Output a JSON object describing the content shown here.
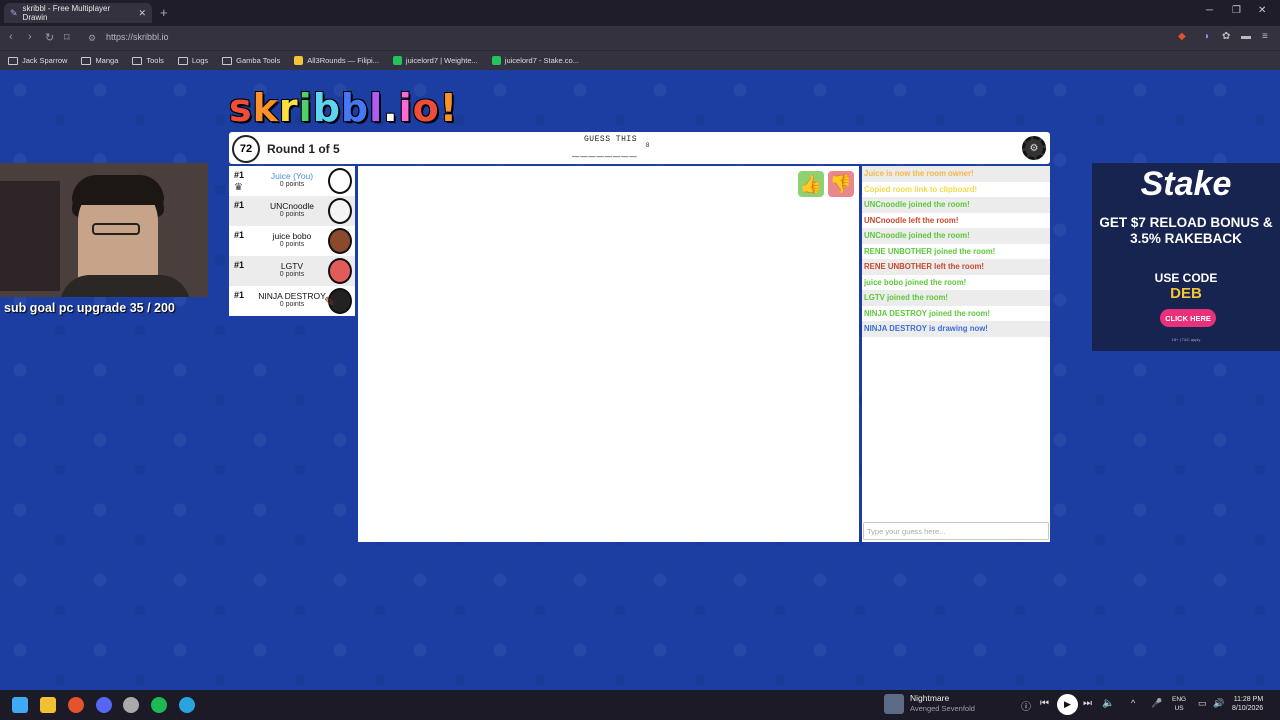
{
  "browser": {
    "tab_title": "skribbl - Free Multiplayer Drawin",
    "tab_close": "✕",
    "new_tab": "+",
    "url": "https://skribbl.io",
    "bookmarks": [
      {
        "label": "Jack Sparrow",
        "icon": "folder-icon"
      },
      {
        "label": "Manga",
        "icon": "folder-icon"
      },
      {
        "label": "Tools",
        "icon": "folder-icon"
      },
      {
        "label": "Logs",
        "icon": "folder-icon"
      },
      {
        "label": "Gamba Tools",
        "icon": "folder-icon"
      },
      {
        "label": "All3Rounds — Filipi...",
        "icon": "site-icon"
      },
      {
        "label": "juicelord7 | Weighte...",
        "icon": "site-icon"
      },
      {
        "label": "juicelord7 - Stake.co...",
        "icon": "site-icon"
      }
    ]
  },
  "game": {
    "logo": [
      "s",
      "k",
      "r",
      "i",
      "b",
      "b",
      "l",
      ".",
      "i",
      "o",
      "!"
    ],
    "logo_colors": [
      "#ef4c3a",
      "#f9922b",
      "#fbe03e",
      "#4dd26a",
      "#5ed4f3",
      "#4478f5",
      "#b05cf0",
      "#ffffff",
      "#ff6ad6",
      "#ef4c3a",
      "#f9922b"
    ],
    "timer": "72",
    "round_text": "Round 1 of 5",
    "guess_label": "GUESS THIS",
    "word_blanks": "________",
    "word_length": "8",
    "players": [
      {
        "rank": "#1",
        "name": "Juice (You)",
        "points": "0 points",
        "me": true,
        "owner": true,
        "avatar_color": "#ffffff"
      },
      {
        "rank": "#1",
        "name": "UNCnoodle",
        "points": "0 points",
        "me": false,
        "owner": false,
        "avatar_color": "#f5f5f5"
      },
      {
        "rank": "#1",
        "name": "juice bobo",
        "points": "0 points",
        "me": false,
        "owner": false,
        "avatar_color": "#8b4a2b"
      },
      {
        "rank": "#1",
        "name": "LGTV",
        "points": "0 points",
        "me": false,
        "owner": false,
        "avatar_color": "#e35a5a"
      },
      {
        "rank": "#1",
        "name": "NINJA DESTROY",
        "points": "0 points",
        "me": false,
        "owner": false,
        "drawing": true,
        "avatar_color": "#222222"
      }
    ],
    "chat": [
      {
        "text": "Juice is now the room owner!",
        "color": "#f2b84a"
      },
      {
        "text": "Copied room link to clipboard!",
        "color": "#f3da4b"
      },
      {
        "text": "UNCnoodle joined the room!",
        "color": "#5cc93a"
      },
      {
        "text": "UNCnoodle left the room!",
        "color": "#c8492d"
      },
      {
        "text": "UNCnoodle joined the room!",
        "color": "#5cc93a"
      },
      {
        "text": "RENE UNBOTHER joined the room!",
        "color": "#5cc93a"
      },
      {
        "text": "RENE UNBOTHER left the room!",
        "color": "#c8492d"
      },
      {
        "text": "juice bobo joined the room!",
        "color": "#5cc93a"
      },
      {
        "text": "LGTV joined the room!",
        "color": "#5cc93a"
      },
      {
        "text": "NINJA DESTROY joined the room!",
        "color": "#5cc93a"
      },
      {
        "text": "NINJA DESTROY is drawing now!",
        "color": "#3b6fd8"
      }
    ],
    "chat_placeholder": "Type your guess here..."
  },
  "stream": {
    "subgoal": "sub goal pc upgrade 35 / 200"
  },
  "ad": {
    "logo": "Stake",
    "headline": "GET $7 RELOAD BONUS & 3.5% RAKEBACK",
    "code_label": "USE CODE",
    "code": "DEB",
    "button": "CLICK HERE",
    "fine_print": "18+ | T&C apply"
  },
  "taskbar": {
    "media_title": "Nightmare",
    "media_artist": "Avenged Sevenfold",
    "lang_top": "ENG",
    "lang_bottom": "US",
    "time": "11:28 PM",
    "date": "8/10/2026"
  }
}
